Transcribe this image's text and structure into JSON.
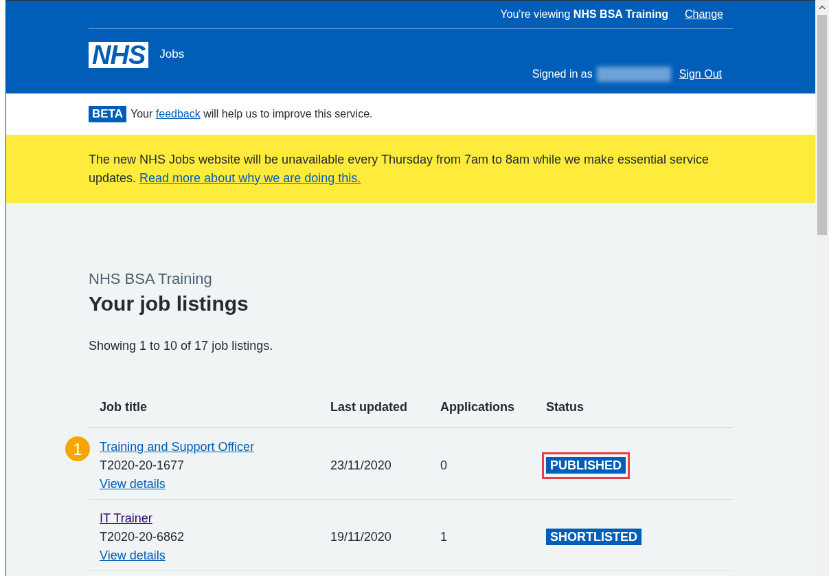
{
  "header": {
    "viewing_prefix": "You're viewing",
    "organisation": "NHS BSA Training",
    "change_link": "Change",
    "logo": "NHS",
    "service_name": "Jobs",
    "signed_in_label": "Signed in as",
    "sign_out_link": "Sign Out"
  },
  "beta_banner": {
    "tag": "BETA",
    "before": "Your",
    "link": "feedback",
    "after": "will help us to improve this service."
  },
  "notice": {
    "text": "The new NHS Jobs website will be unavailable every Thursday from 7am to 8am while we make essential service updates.",
    "link": "Read more about why we are doing this."
  },
  "caption": "NHS BSA Training",
  "heading": "Your job listings",
  "summary": "Showing 1 to 10 of 17 job listings.",
  "table": {
    "columns": [
      "Job title",
      "Last updated",
      "Applications",
      "Status"
    ],
    "rows": [
      {
        "title": "Training and Support Officer",
        "visited": false,
        "reference": "T2020-20-1677",
        "details_link": "View details",
        "updated": "23/11/2020",
        "applications": "0",
        "status": "PUBLISHED",
        "callout": "1",
        "highlighted": true
      },
      {
        "title": "IT Trainer",
        "visited": true,
        "reference": "T2020-20-6862",
        "details_link": "View details",
        "updated": "19/11/2020",
        "applications": "1",
        "status": "SHORTLISTED",
        "highlighted": false
      }
    ]
  }
}
